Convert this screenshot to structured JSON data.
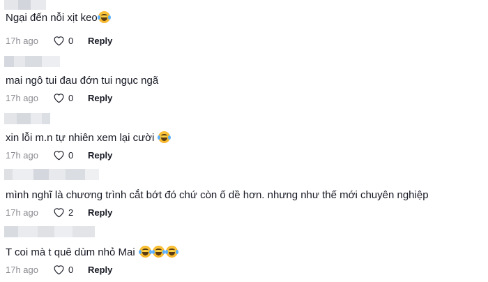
{
  "comments": [
    {
      "text": "Ngại đến nỗi xịt keo",
      "emojis": 1,
      "time": "17h ago",
      "likes": "0",
      "reply": "Reply"
    },
    {
      "text": "mai ngô tui đau đớn tui ngục ngã",
      "emojis": 0,
      "time": "17h ago",
      "likes": "0",
      "reply": "Reply"
    },
    {
      "text": "xin lỗi m.n tự nhiên xem lại cười",
      "emojis": 1,
      "time": "17h ago",
      "likes": "0",
      "reply": "Reply"
    },
    {
      "text": "mình nghĩ là chương trình cắt bớt đó chứ còn ố dề hơn. nhưng như thế mới chuyên nghiệp",
      "emojis": 0,
      "time": "17h ago",
      "likes": "2",
      "reply": "Reply"
    },
    {
      "text": "T coi mà t quê dùm nhỏ Mai",
      "emojis": 3,
      "time": "17h ago",
      "likes": "0",
      "reply": "Reply"
    }
  ],
  "icons": {
    "like": "heart-outline-icon",
    "emoji": "laughing-tears-emoji-icon"
  },
  "colors": {
    "text": "#161823",
    "muted": "#8a8b91",
    "blur": "#d9dbe0"
  }
}
